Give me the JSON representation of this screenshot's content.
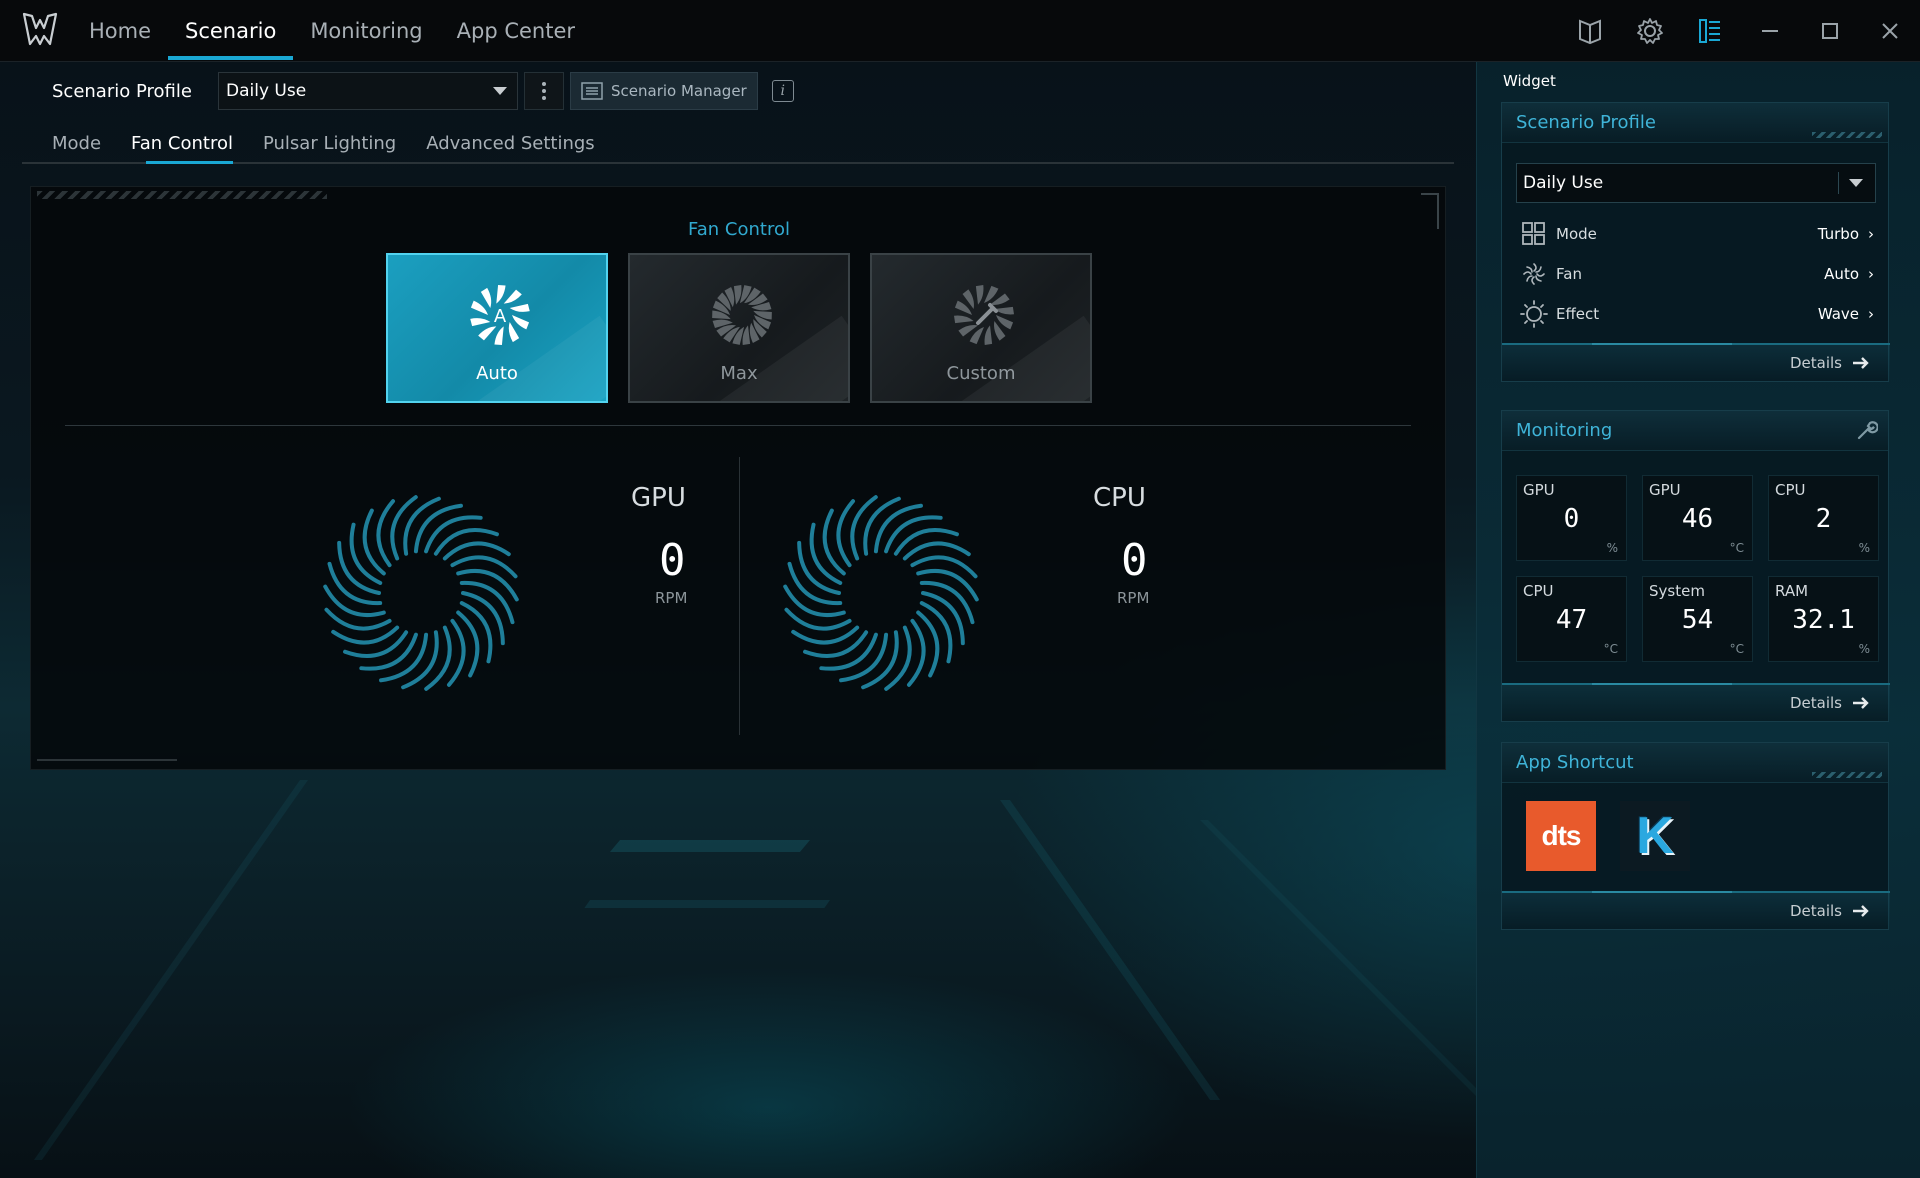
{
  "nav": {
    "tabs": [
      {
        "label": "Home"
      },
      {
        "label": "Scenario"
      },
      {
        "label": "Monitoring"
      },
      {
        "label": "App Center"
      }
    ],
    "active_index": 1
  },
  "profile": {
    "label": "Scenario Profile",
    "selected": "Daily Use",
    "manager_label": "Scenario Manager"
  },
  "subtabs": [
    {
      "label": "Mode"
    },
    {
      "label": "Fan Control"
    },
    {
      "label": "Pulsar Lighting"
    },
    {
      "label": "Advanced Settings"
    }
  ],
  "fan_control": {
    "title": "Fan Control",
    "modes": [
      {
        "label": "Auto",
        "icon": "fan-auto-icon",
        "active": true
      },
      {
        "label": "Max",
        "icon": "fan-max-icon",
        "active": false
      },
      {
        "label": "Custom",
        "icon": "fan-custom-icon",
        "active": false
      }
    ],
    "fans": [
      {
        "name": "GPU",
        "rpm": "0",
        "unit": "RPM"
      },
      {
        "name": "CPU",
        "rpm": "0",
        "unit": "RPM"
      }
    ]
  },
  "widget": {
    "title": "Widget",
    "scenario_profile": {
      "title": "Scenario Profile",
      "selected": "Daily Use",
      "rows": [
        {
          "label": "Mode",
          "value": "Turbo",
          "icon": "mode-grid-icon"
        },
        {
          "label": "Fan",
          "value": "Auto",
          "icon": "fan-icon"
        },
        {
          "label": "Effect",
          "value": "Wave",
          "icon": "sun-effect-icon"
        }
      ],
      "details": "Details"
    },
    "monitoring": {
      "title": "Monitoring",
      "tiles": [
        {
          "label": "GPU",
          "value": "0",
          "unit": "%"
        },
        {
          "label": "GPU",
          "value": "46",
          "unit": "°C"
        },
        {
          "label": "CPU",
          "value": "2",
          "unit": "%"
        },
        {
          "label": "CPU",
          "value": "47",
          "unit": "°C"
        },
        {
          "label": "System",
          "value": "54",
          "unit": "°C"
        },
        {
          "label": "RAM",
          "value": "32.1",
          "unit": "%"
        }
      ],
      "details": "Details"
    },
    "app_shortcut": {
      "title": "App Shortcut",
      "apps": [
        {
          "label": "dts",
          "color": "#e85a2c"
        },
        {
          "label": "K",
          "color": "#2aa8e0"
        }
      ],
      "details": "Details"
    }
  },
  "colors": {
    "accent": "#1aa8d4",
    "active_card": "#1b9fc0",
    "fan_blade": "#1f7f9a"
  }
}
